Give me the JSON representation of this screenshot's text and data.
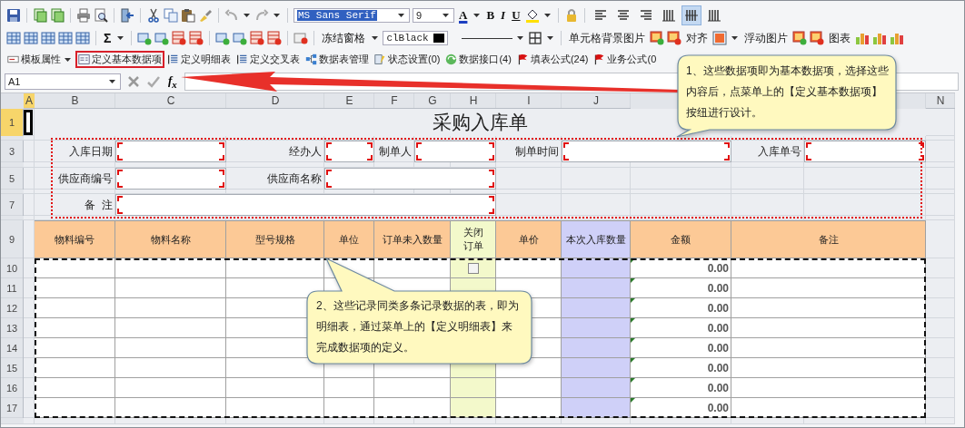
{
  "toolbar": {
    "font": "MS Sans Serif",
    "font_size": "9",
    "font_color_label": "A",
    "bold_label": "B",
    "italic_label": "I",
    "underline_label": "U",
    "align_buttons": [
      {
        "selected": false
      },
      {
        "selected": false
      },
      {
        "selected": false
      },
      {
        "selected": false
      },
      {
        "selected": true
      },
      {
        "selected": false
      }
    ]
  },
  "toolbar2": {
    "sum_label": "Σ",
    "freeze_button": "冻结窗格",
    "color_value": "clBlack",
    "cell_background_label": "单元格背景图片",
    "align_label": "对齐",
    "floating_image_label": "浮动图片",
    "chart_label": "图表"
  },
  "menu": [
    {
      "label": "模板属性",
      "selected": false,
      "has_menu": true
    },
    {
      "label": "定义基本数据项",
      "selected": true,
      "has_menu": false
    },
    {
      "label": "定义明细表",
      "selected": false,
      "has_menu": false
    },
    {
      "label": "定义交叉表",
      "selected": false,
      "has_menu": false
    },
    {
      "label": "数据表管理",
      "selected": false,
      "has_menu": false
    },
    {
      "label": "状态设置(0)",
      "selected": false,
      "has_menu": false
    },
    {
      "label": "数据接口(4)",
      "selected": false,
      "has_menu": false
    },
    {
      "label": "填表公式(24)",
      "selected": false,
      "has_menu": false
    },
    {
      "label": "业务公式(0",
      "selected": false,
      "has_menu": false
    }
  ],
  "formula_bar": {
    "cell_ref": "A1",
    "function_label": "f$_{x}$"
  },
  "sheet": {
    "title": "采购入库单",
    "columns": [
      {
        "label": "A",
        "selected": true
      },
      {
        "label": "B",
        "selected": false
      },
      {
        "label": "C",
        "selected": false
      },
      {
        "label": "D",
        "selected": false
      },
      {
        "label": "E",
        "selected": false
      },
      {
        "label": "F",
        "selected": false
      },
      {
        "label": "G",
        "selected": false
      },
      {
        "label": "H",
        "selected": false
      },
      {
        "label": "I",
        "selected": false
      },
      {
        "label": "J",
        "selected": false
      },
      {
        "label": "N",
        "selected": false
      }
    ],
    "rows": [
      {
        "label": "1",
        "selected": true
      },
      {
        "label": "3",
        "selected": false
      },
      {
        "label": "5",
        "selected": false
      },
      {
        "label": "7",
        "selected": false
      },
      {
        "label": "9",
        "selected": false
      },
      {
        "label": "10",
        "selected": false
      },
      {
        "label": "11",
        "selected": false
      },
      {
        "label": "12",
        "selected": false
      },
      {
        "label": "13",
        "selected": false
      },
      {
        "label": "14",
        "selected": false
      },
      {
        "label": "15",
        "selected": false
      },
      {
        "label": "16",
        "selected": false
      },
      {
        "label": "17",
        "selected": false
      }
    ],
    "form_fields": [
      {
        "label": "入库日期"
      },
      {
        "label": "经办人"
      },
      {
        "label": "制单人"
      },
      {
        "label": "制单时间"
      },
      {
        "label": "入库单号"
      },
      {
        "label": "供应商编号"
      },
      {
        "label": "供应商名称"
      },
      {
        "label": "备  注"
      }
    ],
    "detail_table": {
      "columns": [
        {
          "label": "物料编号",
          "kind": "text"
        },
        {
          "label": "物料名称",
          "kind": "text"
        },
        {
          "label": "型号规格",
          "kind": "text"
        },
        {
          "label": "单位",
          "kind": "text"
        },
        {
          "label": "订单未入数量",
          "kind": "text"
        },
        {
          "label": "关闭订单",
          "kind": "check",
          "color": "#f3f9cb"
        },
        {
          "label": "单价",
          "kind": "text"
        },
        {
          "label": "本次入库数量",
          "kind": "text",
          "color": "#cfd0f8"
        },
        {
          "label": "金额",
          "kind": "amount"
        },
        {
          "label": "备注",
          "kind": "text"
        }
      ],
      "rows": [
        {
          "closed": false,
          "amount": "0.00"
        },
        {
          "amount": "0.00"
        },
        {
          "amount": "0.00"
        },
        {
          "amount": "0.00"
        },
        {
          "amount": "0.00"
        },
        {
          "amount": "0.00"
        },
        {
          "amount": "0.00"
        },
        {
          "amount": "0.00"
        }
      ]
    }
  },
  "callouts": [
    {
      "text": "1、这些数据项即为基本数据项，选择这些内容后，点菜单上的【定义基本数据项】按纽进行设计。"
    },
    {
      "text": "2、这些记录同类多条记录数据的表，即为明细表，通过菜单上的【定义明细表】来完成数据项的定义。"
    }
  ]
}
